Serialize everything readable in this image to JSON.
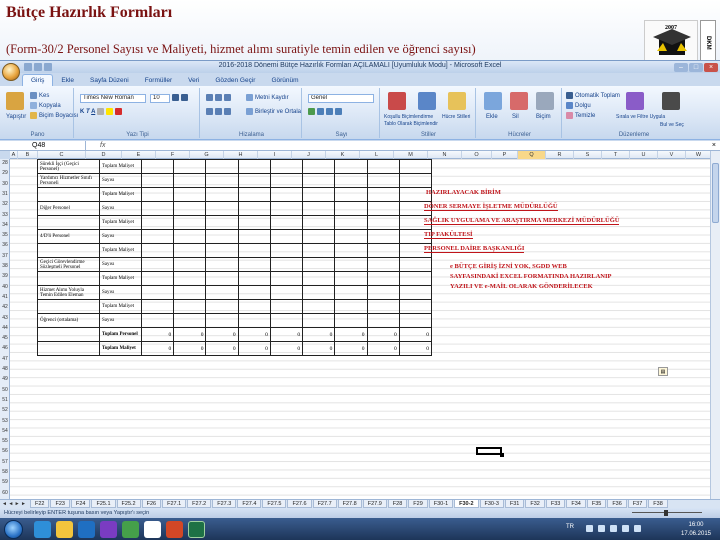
{
  "slide": {
    "title": "Bütçe Hazırlık Formları",
    "subtitle": "(Form-30/2 Personel Sayısı ve Maliyeti, hizmet alımı suratiyle temin edilen ve öğrenci sayısı)",
    "logo_year": "2007",
    "logo_side_text": "DKM"
  },
  "excel": {
    "window_title": "2016-2018 Dönemi Bütçe Hazırlık Formları AÇILAMALI [Uyumluluk Modu] - Microsoft Excel",
    "ribbon_tabs": [
      "Giriş",
      "Ekle",
      "Sayfa Düzeni",
      "Formüller",
      "Veri",
      "Gözden Geçir",
      "Görünüm"
    ],
    "active_tab": "Giriş",
    "ribbon": {
      "clipboard": {
        "cut": "Kes",
        "copy": "Kopyala",
        "format_painter": "Biçim Boyacısı",
        "paste": "Yapıştır",
        "label": "Pano"
      },
      "font": {
        "name": "Times New Roman",
        "size": "10",
        "label": "Yazı Tipi"
      },
      "alignment": {
        "wrap": "Metni Kaydır",
        "merge": "Birleştir ve Ortala",
        "label": "Hizalama"
      },
      "number": {
        "format": "Genel",
        "label": "Sayı"
      },
      "styles": {
        "conditional": "Koşullu Biçimlendirme",
        "table": "Tablo Olarak Biçimlendir",
        "cell": "Hücre Stilleri",
        "label": "Stiller"
      },
      "cells": {
        "insert": "Ekle",
        "delete": "Sil",
        "format": "Biçim",
        "label": "Hücreler"
      },
      "editing": {
        "autosum": "Otomatik Toplam",
        "fill": "Dolgu",
        "clear": "Temizle",
        "sort": "Sırala ve Filtre Uygula",
        "find": "Bul ve Seç",
        "label": "Düzenleme"
      }
    },
    "name_box": "Q48",
    "fx": "fx",
    "columns": [
      "A",
      "B",
      "C",
      "D",
      "E",
      "F",
      "G",
      "H",
      "I",
      "J",
      "K",
      "L",
      "M",
      "N",
      "O",
      "P",
      "Q",
      "R",
      "S",
      "T",
      "U",
      "V",
      "W"
    ],
    "selected_column": "Q",
    "rows": [
      "28",
      "29",
      "30",
      "31",
      "32",
      "33",
      "34",
      "35",
      "36",
      "37",
      "38",
      "39",
      "40",
      "41",
      "42",
      "43",
      "44",
      "45",
      "46",
      "47",
      "48",
      "49",
      "50",
      "51",
      "52",
      "53",
      "54",
      "55",
      "56",
      "57",
      "58",
      "59",
      "60"
    ],
    "form_rows": [
      {
        "label": "Sürekli İşçi (Geçici Personel)",
        "type": "Toplam Maliyet"
      },
      {
        "label": "Yardımcı Hizmetler Sınıfı Personeli",
        "type": "Sayısı"
      },
      {
        "label": "",
        "type": "Toplam Maliyet"
      },
      {
        "label": "Diğer Personel",
        "type": "Sayısı"
      },
      {
        "label": "",
        "type": "Toplam Maliyet"
      },
      {
        "label": "4/D'li Personel",
        "type": "Sayısı"
      },
      {
        "label": "",
        "type": "Toplam Maliyet"
      },
      {
        "label": "Geçici Görevlendirme Sözleşmeli Personel",
        "type": "Sayısı"
      },
      {
        "label": "",
        "type": "Toplam Maliyet"
      },
      {
        "label": "Hizmet Alımı Yoluyla Temin Edilen Eleman",
        "type": "Sayısı"
      },
      {
        "label": "",
        "type": "Toplam Maliyet"
      },
      {
        "label": "Öğrenci (ortalama)",
        "type": "Sayısı"
      }
    ],
    "totals": {
      "personnel_label": "Toplam Personel",
      "cost_label": "Toplam Maliyet",
      "personnel_values": [
        "0",
        "0",
        "0",
        "0",
        "0",
        "0",
        "0",
        "0",
        "0"
      ],
      "cost_values": [
        "0",
        "0",
        "0",
        "0",
        "0",
        "0",
        "0",
        "0",
        "0"
      ]
    },
    "red_block": [
      "HAZIRLAYACAK BİRİM",
      "DÖNER SERMAYE İŞLETME MÜDÜRLÜĞÜ",
      "SAĞLIK UYGULAMA VE ARAŞTIRMA MERKEZİ MÜDÜRLÜĞÜ",
      "TIP FAKÜLTESİ",
      "PERSONEL DAİRE BAŞKANLIĞI"
    ],
    "red_note": [
      "e BÜTÇE GİRİŞ İZNİ YOK, SGDD WEB",
      "SAYFASINDAKİ EXCEL FORMATINDA HAZIRLANIP",
      "YAZILI VE e-MAİL OLARAK GÖNDERİLECEK"
    ],
    "sheet_tabs": [
      "F22",
      "F23",
      "F24",
      "F25.1",
      "F25.2",
      "F26",
      "F27.1",
      "F27.2",
      "F27.3",
      "F27.4",
      "F27.5",
      "F27.6",
      "F27.7",
      "F27.8",
      "F27.9",
      "F28",
      "F29",
      "F30-1",
      "F30-2",
      "F30-3",
      "F31",
      "F32",
      "F33",
      "F34",
      "F35",
      "F36",
      "F37",
      "F38"
    ],
    "active_sheet": "F30-2",
    "status_text": "Hücreyi belirleyip ENTER tuşuna basın veya Yapıştır'ı seçin",
    "taskbar": {
      "lang": "TR",
      "time": "16:00",
      "date": "17.06.2015"
    }
  }
}
